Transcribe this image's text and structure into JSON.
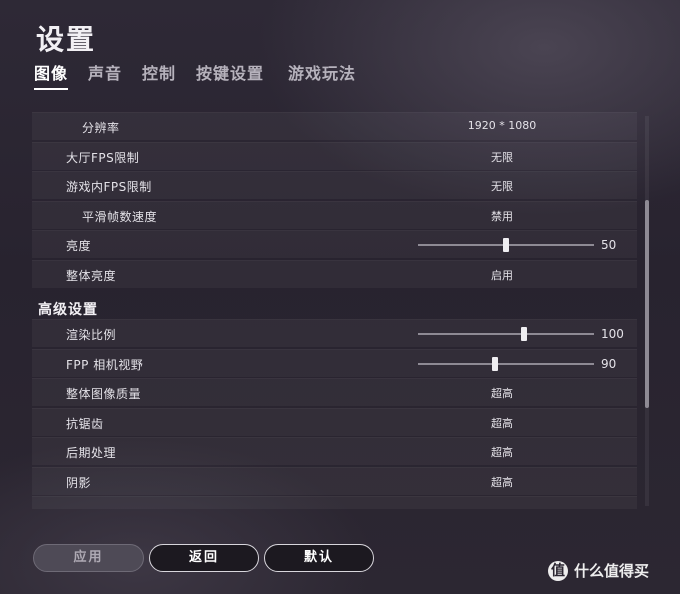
{
  "header": {
    "title": "设置"
  },
  "tabs": [
    {
      "label": "图像",
      "active": true
    },
    {
      "label": "声音",
      "active": false
    },
    {
      "label": "控制",
      "active": false
    },
    {
      "label": "按键设置",
      "active": false
    },
    {
      "label": "游戏玩法",
      "active": false
    }
  ],
  "settings": {
    "resolution": {
      "label": "分辨率",
      "value": "1920 * 1080"
    },
    "lobby_fps": {
      "label": "大厅FPS限制",
      "value": "无限"
    },
    "ingame_fps": {
      "label": "游戏内FPS限制",
      "value": "无限"
    },
    "smooth_frame": {
      "label": "平滑帧数速度",
      "value": "禁用"
    },
    "brightness": {
      "label": "亮度",
      "value": "50",
      "level": 50,
      "min": 0,
      "max": 100
    },
    "overall_brightness": {
      "label": "整体亮度",
      "value": "启用"
    }
  },
  "advanced": {
    "title": "高级设置",
    "render_scale": {
      "label": "渲染比例",
      "value": "100",
      "level": 100,
      "min": 70,
      "max": 120
    },
    "fpp_fov": {
      "label": "FPP 相机视野",
      "value": "90",
      "level": 90,
      "min": 80,
      "max": 103
    },
    "overall_quality": {
      "label": "整体图像质量",
      "value": "超高"
    },
    "anti_aliasing": {
      "label": "抗锯齿",
      "value": "超高"
    },
    "post_processing": {
      "label": "后期处理",
      "value": "超高"
    },
    "shadows": {
      "label": "阴影",
      "value": "超高"
    }
  },
  "footer": {
    "apply_label": "应用",
    "back_label": "返回",
    "default_label": "默认"
  },
  "watermark": {
    "icon": "值",
    "text": "什么值得买"
  },
  "colors": {
    "background": "#2b2631",
    "text": "#e8e6ea",
    "row": "#38333f"
  }
}
